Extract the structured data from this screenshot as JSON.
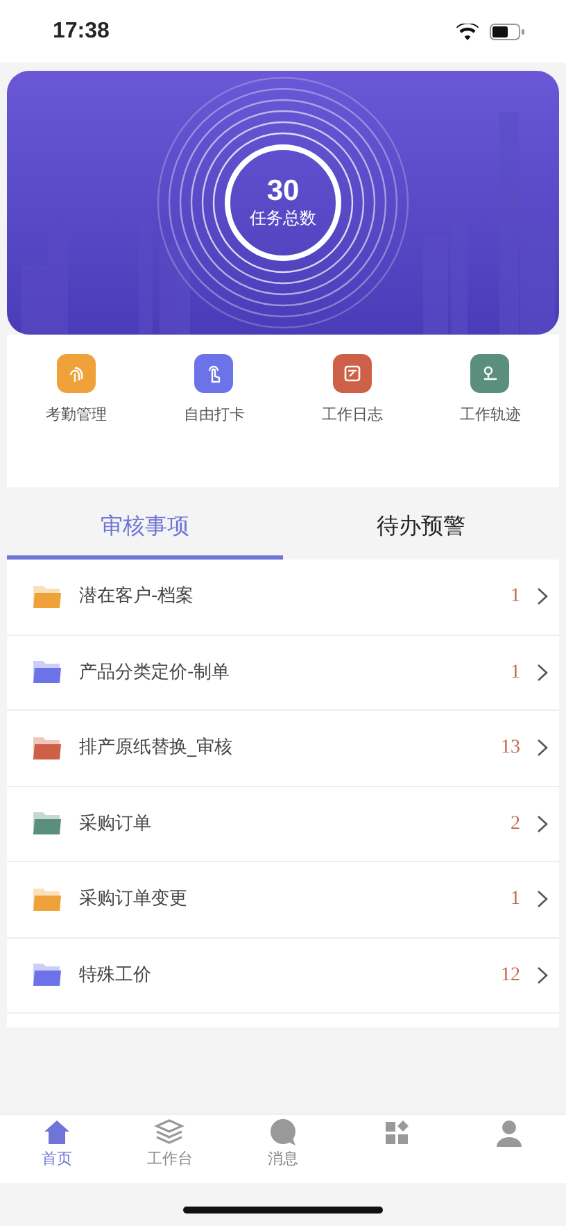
{
  "status_bar": {
    "time": "17:38"
  },
  "banner": {
    "count": "30",
    "label": "任务总数"
  },
  "shortcuts": [
    {
      "label": "考勤管理",
      "color": "#efa23a"
    },
    {
      "label": "自由打卡",
      "color": "#6c72e8"
    },
    {
      "label": "工作日志",
      "color": "#cf6048"
    },
    {
      "label": "工作轨迹",
      "color": "#5a8e7d"
    }
  ],
  "tabs": [
    {
      "label": "审核事项",
      "selected": true
    },
    {
      "label": "待办预警",
      "selected": false
    }
  ],
  "items": [
    {
      "title": "潜在客户-档案",
      "count": "1",
      "color": "#efa23a"
    },
    {
      "title": "产品分类定价-制单",
      "count": "1",
      "color": "#6c72e8"
    },
    {
      "title": "排产原纸替换_审核",
      "count": "13",
      "color": "#cf6048"
    },
    {
      "title": "采购订单",
      "count": "2",
      "color": "#5a8e7d"
    },
    {
      "title": "采购订单变更",
      "count": "1",
      "color": "#efa23a"
    },
    {
      "title": "特殊工价",
      "count": "12",
      "color": "#6c72e8"
    }
  ],
  "bottom_nav": [
    {
      "label": "首页",
      "selected": true
    },
    {
      "label": "工作台",
      "selected": false
    },
    {
      "label": "消息",
      "selected": false
    },
    {
      "selected": false
    },
    {
      "selected": false
    }
  ]
}
